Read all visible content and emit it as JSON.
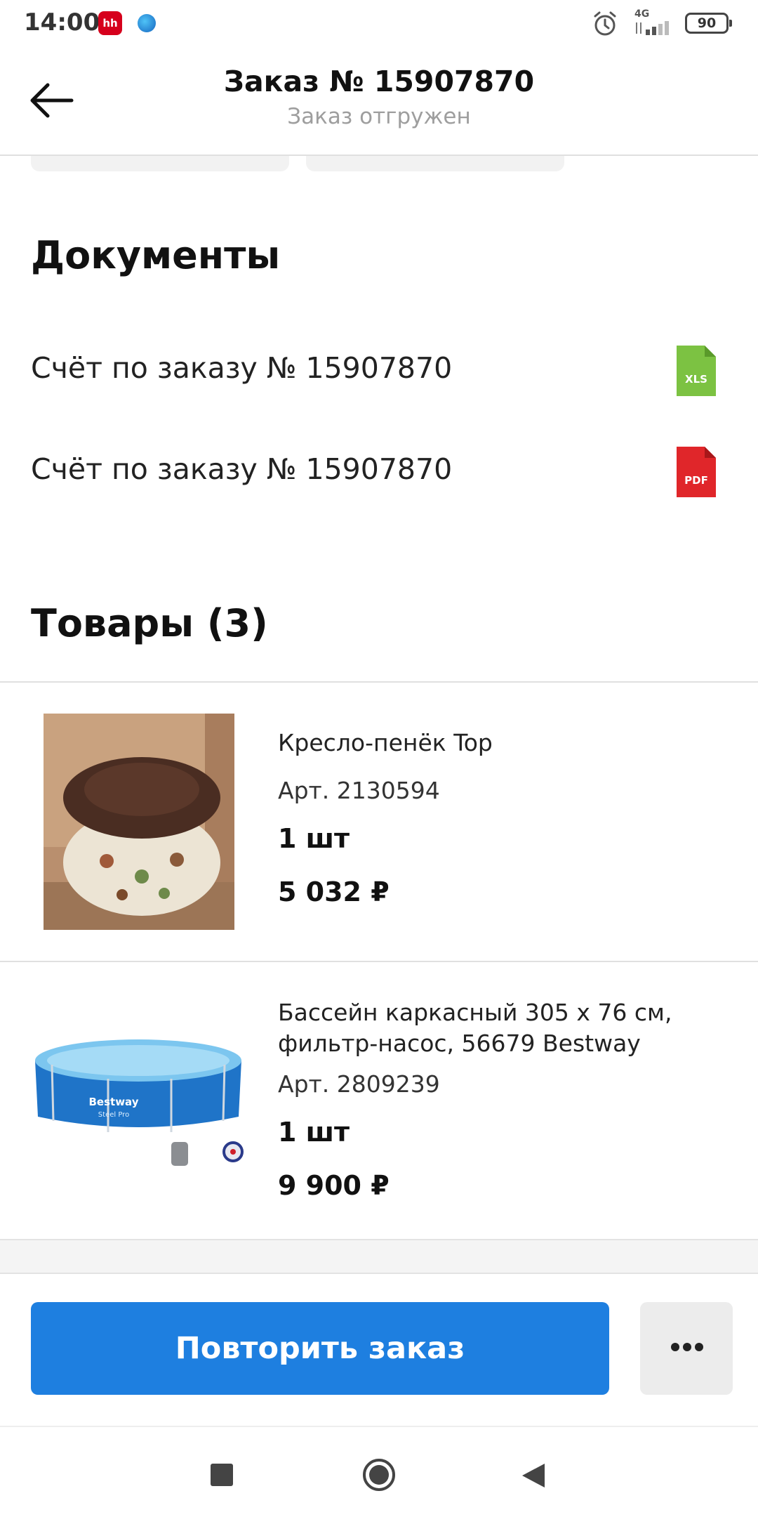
{
  "status_bar": {
    "time": "14:00",
    "hh_badge": "hh",
    "network": "4G",
    "battery": "90",
    "icons": [
      "hh-app-icon",
      "browser-dot-icon",
      "alarm-icon",
      "signal-icon",
      "battery-icon"
    ]
  },
  "header": {
    "title": "Заказ № 15907870",
    "subtitle": "Заказ отгружен",
    "back_icon": "arrow-left-icon"
  },
  "documents": {
    "title": "Документы",
    "items": [
      {
        "label": "Счёт по заказу № 15907870",
        "file_type": "XLS",
        "icon_color": "#7cc242"
      },
      {
        "label": "Счёт по заказу № 15907870",
        "file_type": "PDF",
        "icon_color": "#e0262a"
      }
    ]
  },
  "products": {
    "title": "Товары (3)",
    "items": [
      {
        "name": "Кресло-пенёк Top",
        "article": "Арт. 2130594",
        "quantity": "1 шт",
        "price": "5 032 ₽"
      },
      {
        "name": "Бассейн каркасный 305 х 76 см, фильтр-насос, 56679 Bestway",
        "article": "Арт. 2809239",
        "quantity": "1 шт",
        "price": "9 900 ₽",
        "image_brand": "Bestway",
        "image_sub": "Steel Pro"
      }
    ]
  },
  "actions": {
    "repeat_label": "Повторить заказ",
    "more_icon": "more-horizontal-icon",
    "accent_color": "#1e7fe0"
  },
  "navbar": {
    "icons": [
      "recents-icon",
      "home-icon",
      "back-triangle-icon"
    ]
  }
}
